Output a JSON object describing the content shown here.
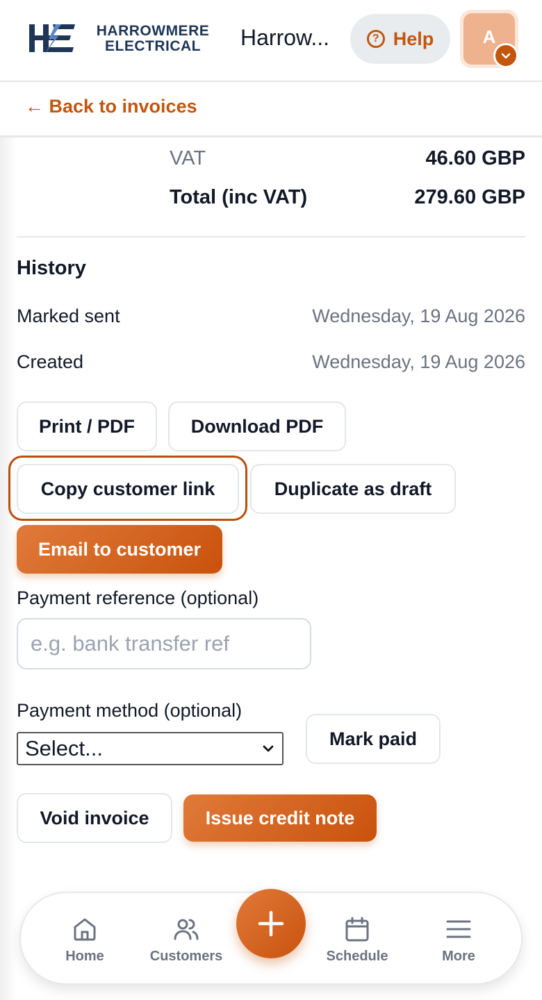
{
  "header": {
    "brand_line1": "HARROWMERE",
    "brand_line2": "ELECTRICAL",
    "app_title": "Harrow...",
    "help_label": "Help",
    "avatar_initial": "A"
  },
  "nav": {
    "back_label": "Back to invoices"
  },
  "totals": {
    "vat_label": "VAT",
    "vat_value": "46.60 GBP",
    "total_label": "Total (inc VAT)",
    "total_value": "279.60 GBP"
  },
  "history": {
    "title": "History",
    "entries": [
      {
        "label": "Marked sent",
        "date": "Wednesday, 19 Aug 2026"
      },
      {
        "label": "Created",
        "date": "Wednesday, 19 Aug 2026"
      }
    ]
  },
  "actions": {
    "print_pdf": "Print / PDF",
    "download_pdf": "Download PDF",
    "copy_link": "Copy customer link",
    "duplicate": "Duplicate as draft",
    "email": "Email to customer"
  },
  "payment": {
    "reference_label": "Payment reference (optional)",
    "reference_placeholder": "e.g. bank transfer ref",
    "reference_value": "",
    "method_label": "Payment method (optional)",
    "method_selected": "Select...",
    "mark_paid": "Mark paid"
  },
  "danger_actions": {
    "void": "Void invoice",
    "credit_note": "Issue credit note"
  },
  "bottom_nav": {
    "home": "Home",
    "customers": "Customers",
    "schedule": "Schedule",
    "more": "More"
  },
  "colors": {
    "accent": "#c2560d",
    "brand_navy": "#1e3556",
    "muted_text": "#6b7280"
  }
}
